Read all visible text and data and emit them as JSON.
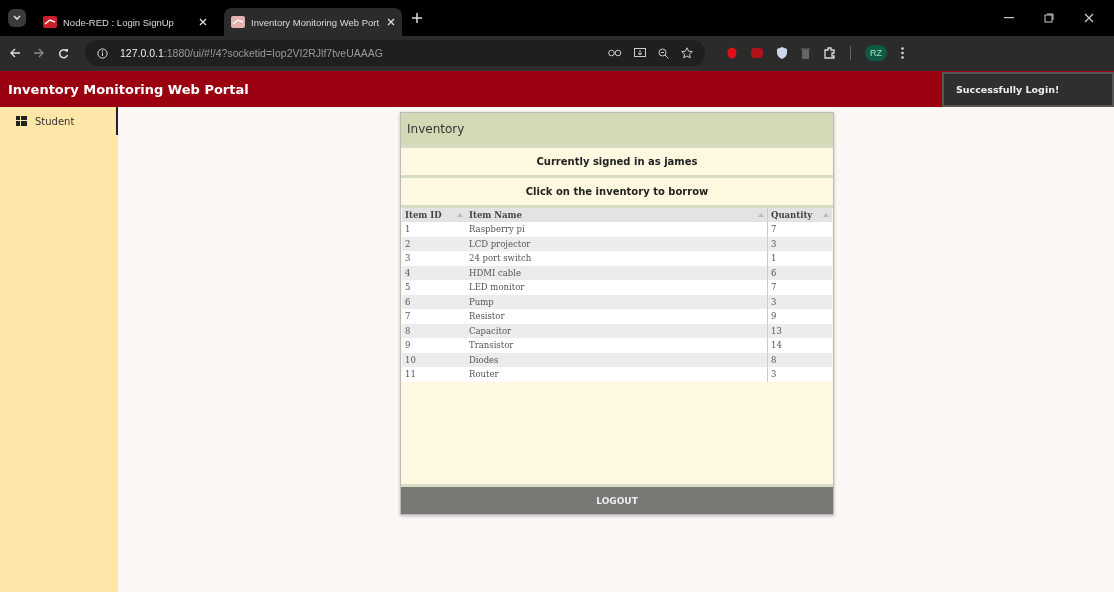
{
  "browser": {
    "tabs": [
      {
        "title": "Node-RED : Login SignUp",
        "selected": false
      },
      {
        "title": "Inventory Monitoring Web Port",
        "selected": true
      }
    ],
    "url_host": "127.0.0.1",
    "url_rest": ":1880/ui/#!/4?socketid=Iop2VI2RJlf7tveUAAAG",
    "profile": "RZ"
  },
  "header": {
    "title": "Inventory Monitoring Web Portal"
  },
  "toast": {
    "text": "Successfully Login!"
  },
  "sidebar": {
    "items": [
      {
        "label": "Student",
        "selected": true
      }
    ]
  },
  "card": {
    "title": "Inventory",
    "messages": [
      "Currently signed in as james",
      "Click on the inventory to borrow"
    ],
    "table": {
      "columns": [
        "Item ID",
        "Item Name",
        "Quantity"
      ],
      "rows": [
        [
          "1",
          "Raspberry pi",
          "7"
        ],
        [
          "2",
          "LCD projector",
          "3"
        ],
        [
          "3",
          "24 port switch",
          "1"
        ],
        [
          "4",
          "HDMI cable",
          "6"
        ],
        [
          "5",
          "LED monitor",
          "7"
        ],
        [
          "6",
          "Pump",
          "3"
        ],
        [
          "7",
          "Resistor",
          "9"
        ],
        [
          "8",
          "Capacitor",
          "13"
        ],
        [
          "9",
          "Transistor",
          "14"
        ],
        [
          "10",
          "Diodes",
          "8"
        ],
        [
          "11",
          "Router",
          "3"
        ]
      ]
    },
    "button": "LOGOUT"
  }
}
